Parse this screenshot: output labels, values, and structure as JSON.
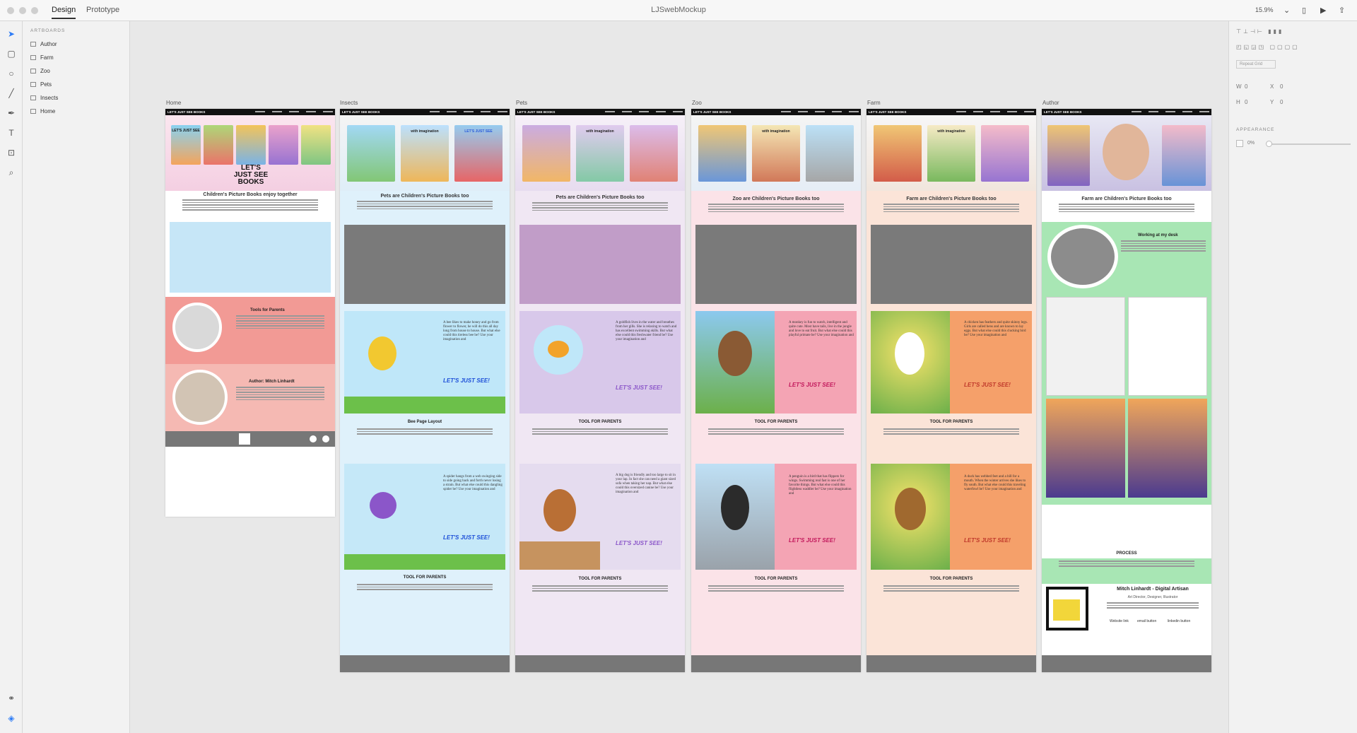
{
  "window": {
    "title": "LJSwebMockup",
    "tabs": [
      "Design",
      "Prototype"
    ],
    "zoom": "15.9%"
  },
  "layers": {
    "title": "ARTBOARDS",
    "items": [
      "Author",
      "Farm",
      "Zoo",
      "Pets",
      "Insects",
      "Home"
    ]
  },
  "properties": {
    "repeat_grid": "Repeat Grid",
    "w": "W",
    "w_val": "0",
    "x": "X",
    "x_val": "0",
    "h": "H",
    "h_val": "0",
    "y": "Y",
    "y_val": "0",
    "appearance": "APPEARANCE",
    "opacity": "0%"
  },
  "artboards": {
    "home": {
      "label": "Home",
      "brand": "LET'S JUST SEE BOOKS",
      "heading": "Children's Picture Books enjoy together",
      "tools_title": "Tools for Parents",
      "author_title": "Author: Mitch Linhardt",
      "hero_title": "LET'S JUST SEE BOOKS",
      "book_title": "LET'S JUST SEE"
    },
    "insects": {
      "label": "Insects",
      "brand": "LET'S JUST SEE BOOKS",
      "heading": "Pets are Children's Picture Books too",
      "page_layout": "Bee Page Layout",
      "tool": "TOOL FOR PARENTS",
      "bee_text": "A bee likes to make honey and go from flower to flower, he will do this all day long from house to house. But what else could this tireless bee be? Use your imagination and",
      "spider_text": "A spider hangs from a web swinging side to side going back and forth never losing a strain. But what else could this dangling spider be? Use your imagination and",
      "lets": "LET'S JUST SEE!"
    },
    "pets": {
      "label": "Pets",
      "brand": "LET'S JUST SEE BOOKS",
      "heading": "Pets are Children's Picture Books too",
      "tool": "TOOL FOR PARENTS",
      "fish_text": "A goldfish lives in the water and breathes from her gills. She is relaxing to watch and has excellent swimming skills. But what else could this freshwater friend be? Use your imagination and",
      "dog_text": "A big dog is friendly and too large to sit in your lap. In fact she can need a giant sized sofa when taking her nap. But what else could this oversized canine be? Use your imagination and",
      "lets": "LET'S JUST SEE!"
    },
    "zoo": {
      "label": "Zoo",
      "brand": "LET'S JUST SEE BOOKS",
      "heading": "Zoo are Children's Picture Books too",
      "tool": "TOOL FOR PARENTS",
      "monkey_text": "A monkey is fun to watch, intelligent and quite cute. Most have tails, live in the jungle and love to eat fruit. But what else could this playful primate be? Use your imagination and",
      "penguin_text": "A penguin is a bird that has flippers for wings. Swimming real fast is one of her favorite things. But what else could this flightless waddler be? Use your imagination and",
      "lets": "LET'S JUST SEE!"
    },
    "farm": {
      "label": "Farm",
      "brand": "LET'S JUST SEE BOOKS",
      "heading": "Farm are Children's Picture Books too",
      "tool": "TOOL FOR PARENTS",
      "chicken_text": "A chicken has feathers and quite skinny legs. Girls are called hens and are known to lay eggs. But what else could this clucking bird be? Use your imagination and",
      "duck_text": "A duck has webbed feet and a bill for a mouth. When the winter arrives she likes to fly south. But what else could this traveling waterfowl be? Use your imagination and",
      "lets": "LET'S JUST SEE!"
    },
    "author": {
      "label": "Author",
      "brand": "LET'S JUST SEE BOOKS",
      "heading": "Farm are Children's Picture Books too",
      "working": "Working at my desk",
      "process": "PROCESS",
      "name": "Mitch Linhardt - Digital Artisan",
      "role": "Art Director, Designer, Illustrator",
      "link1": "Website link",
      "link2": "email button",
      "link3": "linkedin button"
    }
  },
  "book_cover": {
    "line1": "with imagination",
    "line2": "LET'S JUST SEE"
  },
  "colors": {
    "home_panel": "#c6e6f7",
    "pink": "#f29a95",
    "insects_bg": "#dff1fb",
    "pets_bg": "#f0e7f3",
    "zoo_bg": "#fbe3e8",
    "farm_bg": "#fbe4d8",
    "author_green": "#a8e6b4",
    "gray": "#7a7a7a",
    "accent": "#2d7cf6"
  }
}
